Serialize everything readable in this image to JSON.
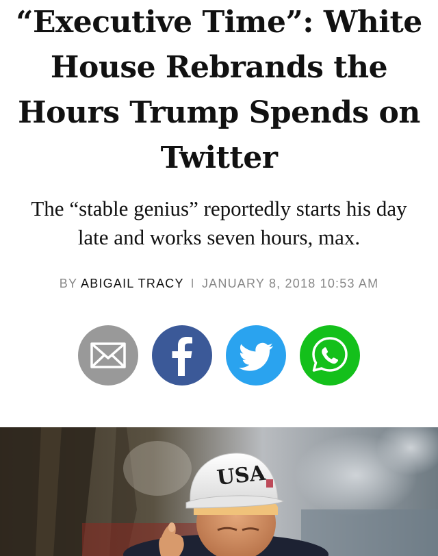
{
  "article": {
    "headline": "“Executive Time”: White House Rebrands the Hours Trump Spends on Twitter",
    "dek": "The “stable genius” reportedly starts his day late and works seven hours, max.",
    "byline": {
      "prefix": "BY",
      "author": "ABIGAIL TRACY",
      "separator": "I",
      "date": "JANUARY 8, 2018 10:53 AM"
    }
  },
  "share": {
    "buttons": [
      {
        "name": "email",
        "icon": "envelope-icon",
        "color": "#999999"
      },
      {
        "name": "facebook",
        "icon": "facebook-f-icon",
        "color": "#3b5998"
      },
      {
        "name": "twitter",
        "icon": "twitter-bird-icon",
        "color": "#2aa3ef"
      },
      {
        "name": "whatsapp",
        "icon": "whatsapp-phone-icon",
        "color": "#14c01b"
      }
    ]
  },
  "hero_image": {
    "cap_text": "USA"
  }
}
